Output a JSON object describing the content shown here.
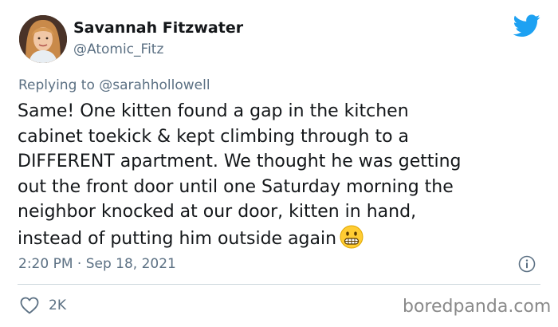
{
  "author": {
    "display_name": "Savannah Fitzwater",
    "handle": "@Atomic_Fitz"
  },
  "reply": {
    "prefix": "Replying to",
    "mention": "@sarahhollowell"
  },
  "tweet": {
    "lines": [
      "Same! One kitten found a gap in the kitchen",
      "cabinet toekick & kept climbing through to a",
      "DIFFERENT apartment. We thought he was getting",
      "out the front door until one Saturday morning the",
      "neighbor knocked at our door, kitten in hand,",
      "instead of putting him outside again"
    ],
    "emoji": "grimacing-face"
  },
  "meta": {
    "timestamp": "2:20 PM · Sep 18, 2021"
  },
  "actions": {
    "like_count": "2K"
  },
  "watermark": "boredpanda.com",
  "colors": {
    "twitter_blue": "#1da1f2",
    "text": "#14171a",
    "secondary": "#5b7083",
    "divider": "#cfd9de"
  }
}
